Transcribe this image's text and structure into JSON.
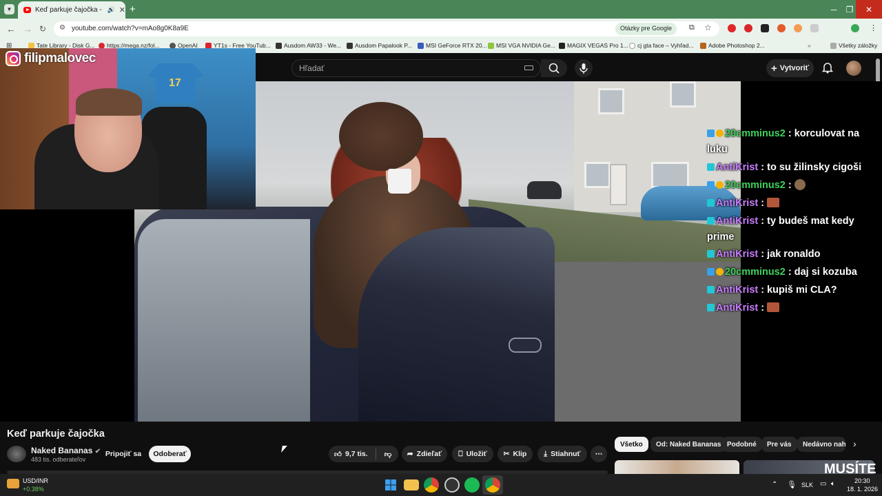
{
  "browser": {
    "tab_title": "Keď parkuje čajočka - YouT",
    "url": "youtube.com/watch?v=mAo8g0K8a9E",
    "google_chip": "Otázky pre Google",
    "bookmarks": [
      "Tate Library - Disk G...",
      "https://mega.nz/fol...",
      "OpenAI",
      "YT1s - Free YouTub...",
      "Ausdom AW33 - We...",
      "Ausdom Papalook P...",
      "MSI GeForce RTX 20...",
      "MSI VGA NVIDIA Ge...",
      "MAGIX VEGAS Pro 1...",
      "cj gta face – Vyhľad...",
      "Adobe Photoshop 2..."
    ],
    "all_bookmarks": "Všetky záložky"
  },
  "youtube": {
    "search_placeholder": "Hľadať",
    "create_label": "Vytvoriť"
  },
  "overlay": {
    "instagram_handle": "filipmalovec",
    "shirt_number": "17"
  },
  "chat": [
    {
      "user": "20cmminus2",
      "text": ": korculovat na luku",
      "color": "#3fd15c"
    },
    {
      "user": "AntiKrist",
      "text": ": to su žilinsky cigoši",
      "color": "#c77dff"
    },
    {
      "user": "20cmminus2",
      "text": ":",
      "color": "#3fd15c",
      "emote": "face"
    },
    {
      "user": "AntiKrist",
      "text": ":",
      "color": "#c77dff",
      "emote": "flag"
    },
    {
      "user": "AntiKrist",
      "text": ": ty budeš mat kedy prime",
      "color": "#c77dff"
    },
    {
      "user": "AntiKrist",
      "text": ": jak ronaldo",
      "color": "#c77dff"
    },
    {
      "user": "20cmminus2",
      "text": ": daj si kozuba",
      "color": "#3fd15c"
    },
    {
      "user": "AntiKrist",
      "text": ": kupiš mi CLA?",
      "color": "#c77dff"
    },
    {
      "user": "AntiKrist",
      "text": ":",
      "color": "#c77dff",
      "emote": "flag"
    }
  ],
  "video": {
    "title": "Keď parkuje čajočka",
    "channel": "Naked Bananas",
    "subscribers": "483 tis. odberateľov",
    "join": "Pripojiť sa",
    "subscribe": "Odoberať",
    "likes": "9,7 tis.",
    "share": "Zdieľať",
    "save": "Uložiť",
    "clip": "Klip",
    "download": "Stiahnuť"
  },
  "chips": [
    "Všetko",
    "Od: Naked Bananas",
    "Podobné",
    "Pre vás",
    "Nedávno nahr"
  ],
  "taskbar": {
    "stock_name": "USD/INR",
    "stock_change": "+0.38%",
    "lang": "SLK",
    "time": "20:30",
    "date": "18. 1. 2026"
  },
  "recommended_thumb_text": "MUSÍTE"
}
